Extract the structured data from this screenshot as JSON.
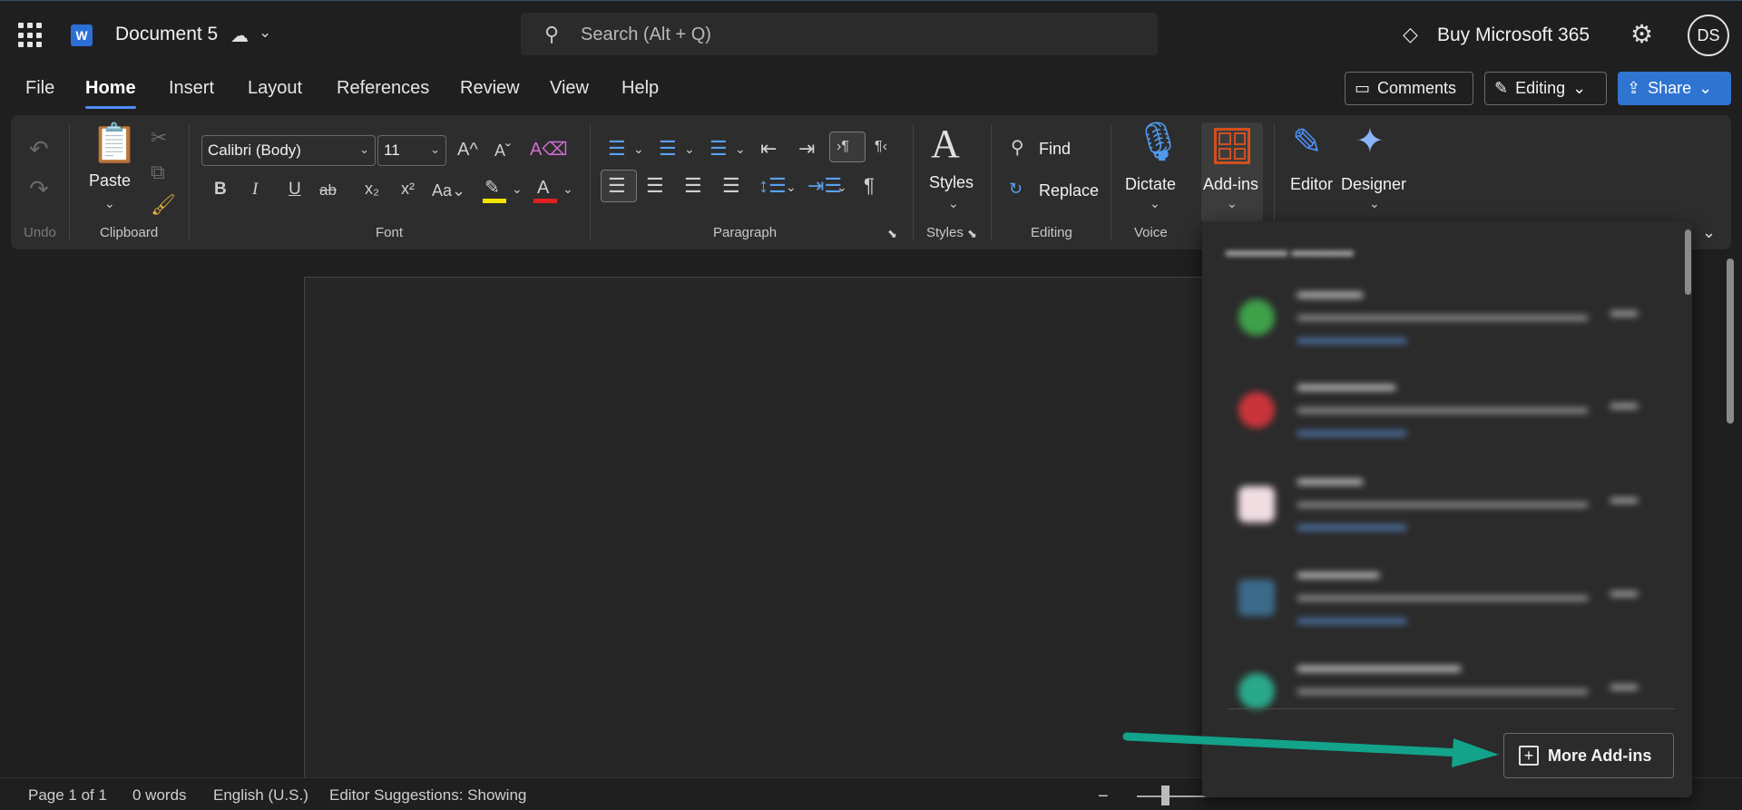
{
  "titlebar": {
    "doc_title": "Document 5",
    "status_icon": "cloud-saved-icon",
    "search_placeholder": "Search (Alt + Q)",
    "buy_label": "Buy Microsoft 365",
    "avatar_initials": "DS",
    "logo_letter": "W"
  },
  "tabs": [
    "File",
    "Home",
    "Insert",
    "Layout",
    "References",
    "Review",
    "View",
    "Help"
  ],
  "actions": {
    "comments": "Comments",
    "editing": "Editing",
    "share": "Share"
  },
  "ribbon": {
    "undo_group": "Undo",
    "clipboard_group": "Clipboard",
    "paste": "Paste",
    "font_group": "Font",
    "font_name": "Calibri (Body)",
    "font_size": "11",
    "paragraph_group": "Paragraph",
    "styles": "Styles",
    "styles_group": "Styles",
    "find": "Find",
    "replace": "Replace",
    "editing_group": "Editing",
    "dictate": "Dictate",
    "voice_group": "Voice",
    "addins": "Add-ins",
    "editor": "Editor",
    "designer": "Designer",
    "highlight_color": "#f5e400",
    "font_color": "#e02020"
  },
  "addins_panel": {
    "more_addins": "More Add-ins"
  },
  "statusbar": {
    "page": "Page 1 of 1",
    "words": "0 words",
    "language": "English (U.S.)",
    "editor_suggestions": "Editor Suggestions: Showing"
  },
  "colors": {
    "accent": "#4f8ef7",
    "share_bg": "#2f74d0",
    "annotation_arrow": "#12a38a"
  }
}
